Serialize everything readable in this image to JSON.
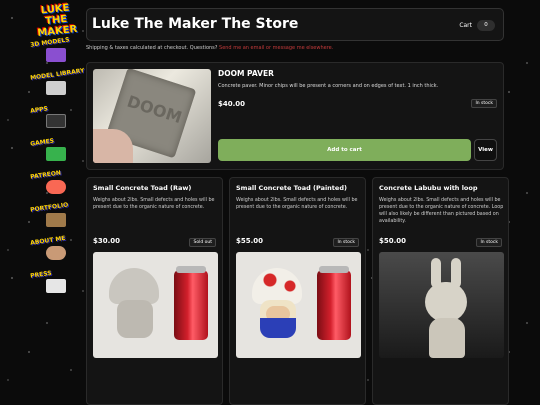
{
  "sidebar": {
    "logo_text": "LUKE THE MAKER",
    "items": [
      {
        "label": "3D MODELS"
      },
      {
        "label": "MODEL LIBRARY"
      },
      {
        "label": "APPS"
      },
      {
        "label": "GAMES"
      },
      {
        "label": "PATREON"
      },
      {
        "label": "PORTFOLIO"
      },
      {
        "label": "ABOUT ME"
      },
      {
        "label": "PRESS"
      }
    ]
  },
  "header": {
    "title": "Luke The Maker The Store",
    "cart_label": "Cart",
    "cart_count": "0"
  },
  "notice": {
    "text": "Shipping & taxes calculated at checkout. Questions? ",
    "link_text": "Send me an email or message me elsewhere."
  },
  "featured": {
    "name": "DOOM PAVER",
    "description": "Concrete paver. Minor chips will be present a corners and on edges of text. 1 inch thick.",
    "price": "$40.00",
    "stock": "In stock",
    "add_to_cart_label": "Add to cart",
    "view_label": "View"
  },
  "products": [
    {
      "name": "Small Concrete Toad (Raw)",
      "description": "Weighs about 2lbs. Small defects and holes will be present due to the organic nature of concrete.",
      "price": "$30.00",
      "stock": "Sold out"
    },
    {
      "name": "Small Concrete Toad (Painted)",
      "description": "Weighs about 2lbs. Small defects and holes will be present due to the organic nature of concrete.",
      "price": "$55.00",
      "stock": "In stock"
    },
    {
      "name": "Concrete Labubu with loop",
      "description": "Weighs about 2lbs. Small defects and holes will be present due to the organic nature of concrete. Loop will also likely be different than pictured based on availability.",
      "price": "$50.00",
      "stock": "In stock"
    }
  ],
  "colors": {
    "accent_green": "#7fae5b",
    "link_red": "#c43b3b",
    "nav_yellow": "#ffd400",
    "background": "#0b0b0b"
  }
}
